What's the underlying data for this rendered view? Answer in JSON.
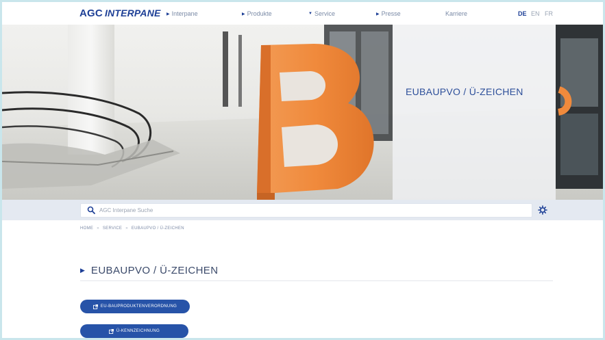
{
  "brand": {
    "name": "AGC",
    "sub": "INTERPANE"
  },
  "nav": {
    "items": [
      {
        "label": "Interpane",
        "marker": "right"
      },
      {
        "label": "Produkte",
        "marker": "right"
      },
      {
        "label": "Service",
        "marker": "down"
      },
      {
        "label": "Presse",
        "marker": "right"
      },
      {
        "label": "Karriere",
        "marker": ""
      }
    ],
    "languages": [
      {
        "code": "DE",
        "active": true
      },
      {
        "code": "EN",
        "active": false
      },
      {
        "code": "FR",
        "active": false
      }
    ]
  },
  "hero": {
    "title": "EUBAUPVO / Ü-ZEICHEN",
    "letter": "B"
  },
  "search": {
    "placeholder": "AGC Interpane Suche",
    "value": ""
  },
  "breadcrumb": [
    "HOME",
    "SERVICE",
    "EUBAUPVO / Ü-ZEICHEN"
  ],
  "page": {
    "title": "EUBAUPVO / Ü-ZEICHEN",
    "buttons": [
      {
        "label": "EU-BAUPRODUKTENVERORDNUNG"
      },
      {
        "label": "Ü-KENNZEICHNUNG"
      }
    ]
  },
  "colors": {
    "brand": "#1d3f96",
    "button": "#2753a8",
    "accent_orange": "#f08a3c",
    "frame": "#c9e6ec"
  }
}
